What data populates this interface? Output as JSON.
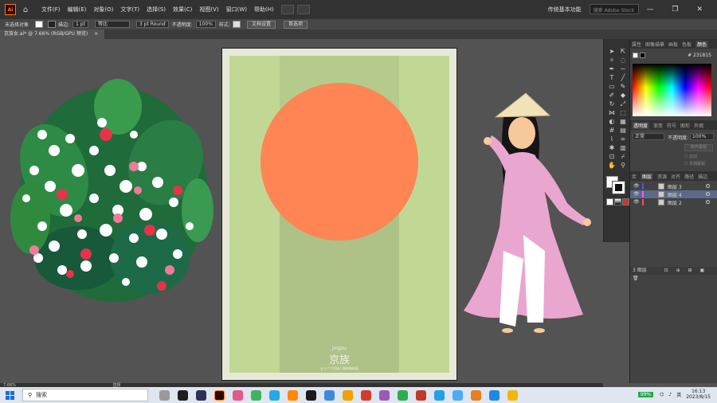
{
  "menubar": {
    "app_logo": "Ai",
    "items": [
      "文件(F)",
      "编辑(E)",
      "对象(O)",
      "文字(T)",
      "选择(S)",
      "效果(C)",
      "视图(V)",
      "窗口(W)",
      "帮助(H)"
    ],
    "workspace": "传统基本功能",
    "search_placeholder": "搜索 Adobe Stock",
    "window_controls": "— ❐ ✕"
  },
  "control_bar": {
    "selection": "未选择对象",
    "stroke_label": "描边:",
    "stroke_value": "1 pt",
    "profile": "等比",
    "brush": "3 pt Round",
    "opacity_label": "不透明度:",
    "opacity_value": "100%",
    "style_label": "样式:",
    "doc_setup": "文档设置",
    "preferences": "首选项"
  },
  "document_tab": {
    "title": "京族女.ai* @ 7.66% (RGB/GPU 预览)",
    "close": "×"
  },
  "artboard": {
    "pinyin": "jingzu",
    "title": "京族",
    "subtitle": "五十六个民族人物神像插画",
    "colors": {
      "bg": "#c1d895",
      "stripe": "#b5cb8c",
      "sun": "#ff8555"
    }
  },
  "color_panel": {
    "tabs": [
      "属性",
      "图像描摹",
      "画板",
      "色板",
      "颜色"
    ],
    "active_tab": "颜色",
    "hex": "231815"
  },
  "transparency_panel": {
    "tabs": [
      "透明度",
      "渐变",
      "符号",
      "图形",
      "外观"
    ],
    "blend_mode": "正常",
    "opacity_label": "不透明度:",
    "opacity_value": "100%",
    "make_mask": "制作蒙版",
    "clip": "剪切",
    "invert_mask": "反相蒙版"
  },
  "layers_panel": {
    "tabs": [
      "库",
      "图层",
      "资源",
      "对齐",
      "路径",
      "描边"
    ],
    "layers": [
      {
        "name": "图层 3",
        "color": "#4f4fff",
        "selected": false
      },
      {
        "name": "图层 4",
        "color": "#ff4fff",
        "selected": true
      },
      {
        "name": "图层 2",
        "color": "#ff4f4f",
        "selected": false
      }
    ],
    "count": "3 图层"
  },
  "status_bar": {
    "zoom": "7.66%",
    "mode": "选择"
  },
  "taskbar": {
    "search": "搜索",
    "battery": "99%",
    "ime": "英",
    "time": "16:13",
    "date": "2023/8/15",
    "app_colors": [
      "#999999",
      "#1e1e1e",
      "#2f2f5a",
      "#330000",
      "#e05a8a",
      "#3fb35f",
      "#27a9e1",
      "#ff8800",
      "#1a1a1a",
      "#3c8ad8",
      "#f0a000",
      "#d43b2a",
      "#9b59b6",
      "#2dae4a",
      "#c0392b",
      "#1fa1e8",
      "#4dabf7",
      "#e67e22",
      "#1e88e5",
      "#f2b705"
    ]
  }
}
